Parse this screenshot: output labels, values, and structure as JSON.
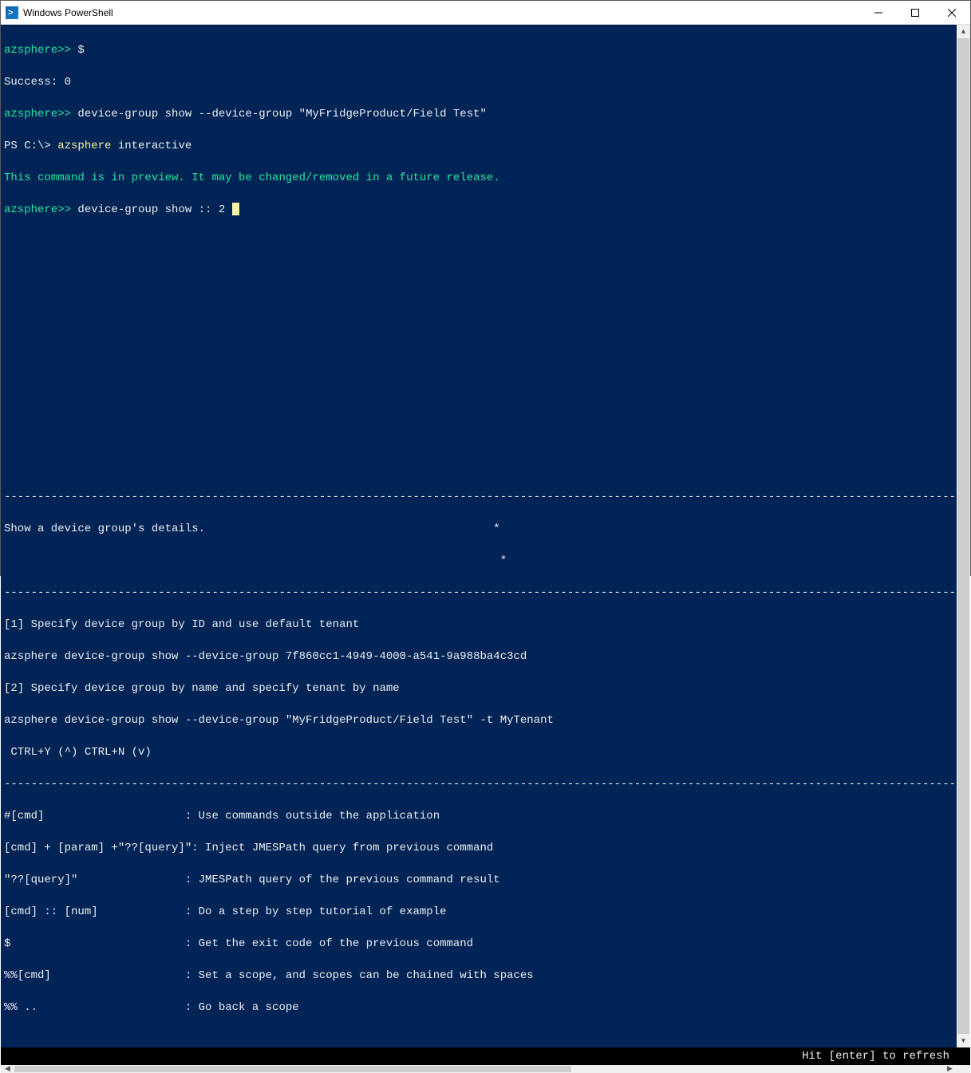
{
  "window": {
    "title": "Windows PowerShell"
  },
  "terminal": {
    "lines": {
      "l1_prompt": "azsphere>>",
      "l1_cmd": " $",
      "l2": "Success: 0",
      "l3_prompt": "azsphere>>",
      "l3_cmd": " device-group show --device-group \"MyFridgeProduct/Field Test\"",
      "l4_ps": "PS C:\\> ",
      "l4_yellow": "azsphere ",
      "l4_rest": "interactive",
      "l5_preview": "This command is in preview. It may be changed/removed in a future release.",
      "l6_prompt": "azsphere>>",
      "l6_cmd": " device-group show :: 2 ",
      "dashrow": "------------------------------------------------------------------------------------------------------------------------------------------------",
      "desc1": "Show a device group's details.                                           *",
      "desc2": "                                                                          *",
      "ex_h1": "[1] Specify device group by ID and use default tenant",
      "ex_c1": "azsphere device-group show --device-group 7f860cc1-4949-4000-a541-9a988ba4c3cd",
      "ex_h2": "[2] Specify device group by name and specify tenant by name",
      "ex_c2": "azsphere device-group show --device-group \"MyFridgeProduct/Field Test\" -t MyTenant",
      "nav": " CTRL+Y (^) CTRL+N (v)",
      "help1": "#[cmd]                     : Use commands outside the application",
      "help2": "[cmd] + [param] +\"??[query]\": Inject JMESPath query from previous command",
      "help3": "\"??[query]\"                : JMESPath query of the previous command result",
      "help4": "[cmd] :: [num]             : Do a step by step tutorial of example",
      "help5": "$                          : Get the exit code of the previous command",
      "help6": "%%[cmd]                    : Set a scope, and scopes can be chained with spaces",
      "help7": "%% ..                      : Go back a scope"
    }
  },
  "bottomBar": {
    "hint": "Hit [enter] to refresh"
  }
}
